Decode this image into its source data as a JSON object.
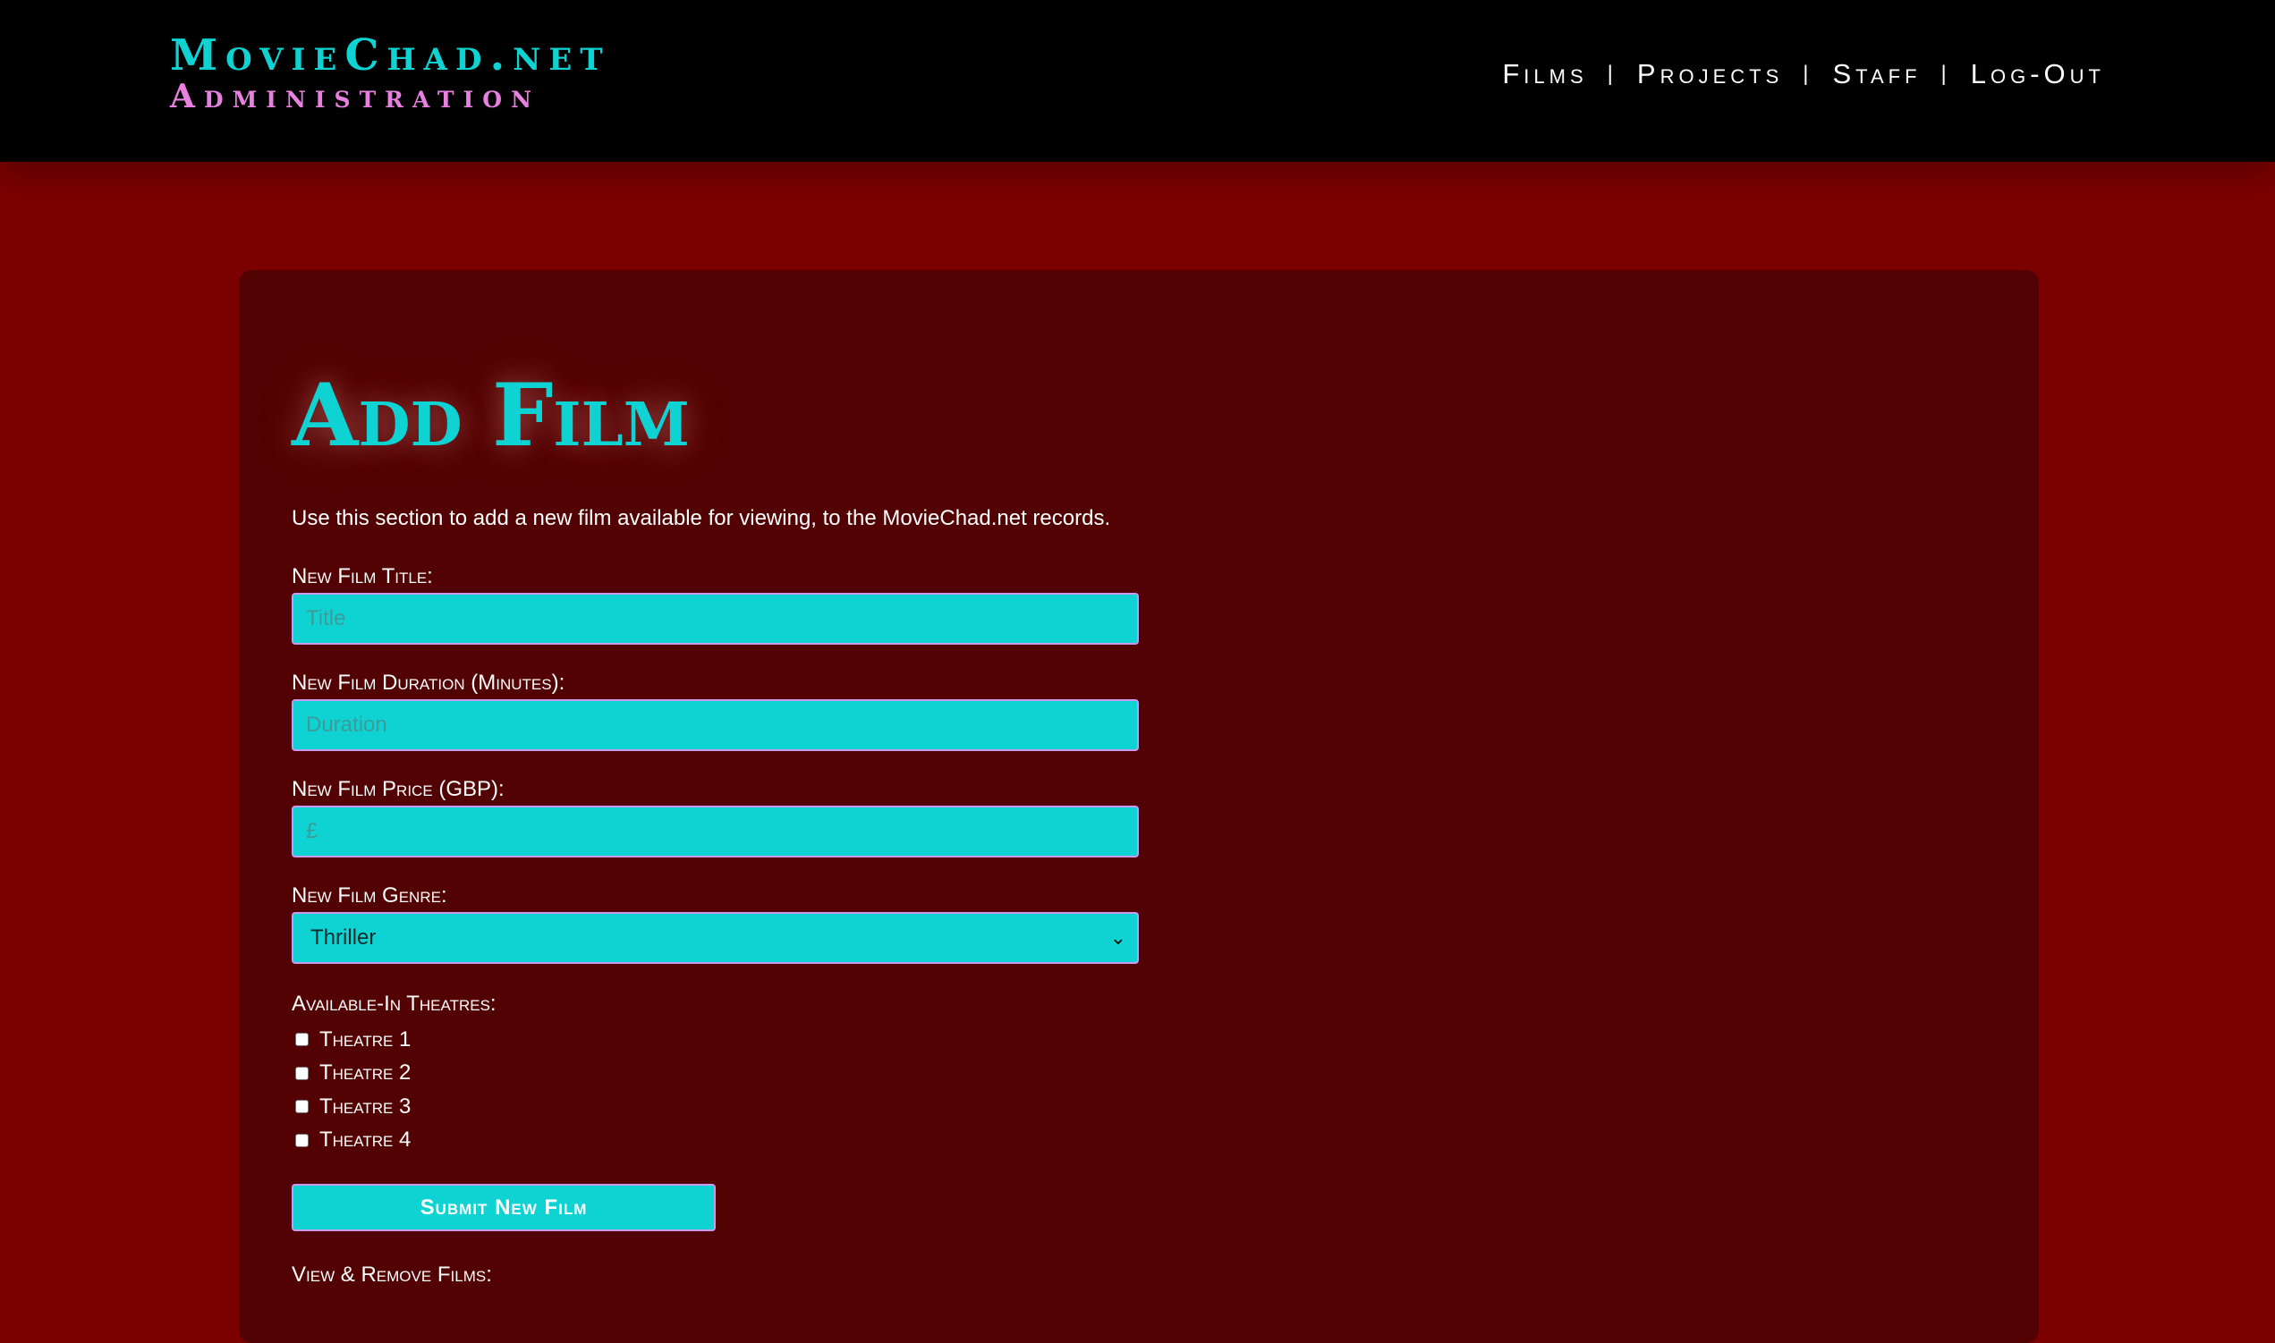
{
  "header": {
    "brand_title": "MovieChad.net",
    "brand_subtitle": "Administration",
    "nav": {
      "films": "Films",
      "projects": "Projects",
      "staff": "Staff",
      "logout": "Log-Out",
      "separator": "|"
    }
  },
  "main": {
    "title": "Add Film",
    "intro": "Use this section to add a new film available for viewing, to the MovieChad.net records.",
    "title_field": {
      "label": "New Film Title:",
      "placeholder": "Title",
      "value": ""
    },
    "duration_field": {
      "label": "New Film Duration (Minutes):",
      "placeholder": "Duration",
      "value": ""
    },
    "price_field": {
      "label": "New Film Price (GBP):",
      "placeholder": "£",
      "value": ""
    },
    "genre_field": {
      "label": "New Film Genre:",
      "selected": "Thriller"
    },
    "theatres": {
      "label": "Available-In Theatres:",
      "options": [
        "Theatre 1",
        "Theatre 2",
        "Theatre 3",
        "Theatre 4"
      ]
    },
    "submit_label": "Submit New Film",
    "view_remove_label": "View & Remove Films:"
  },
  "colors": {
    "background": "#7d0000",
    "panel": "#520202",
    "accent_cyan": "#0fd3d3",
    "accent_pink": "#e880e0",
    "header": "#000000"
  },
  "icons": {
    "select_caret": "chevron-down-icon"
  }
}
